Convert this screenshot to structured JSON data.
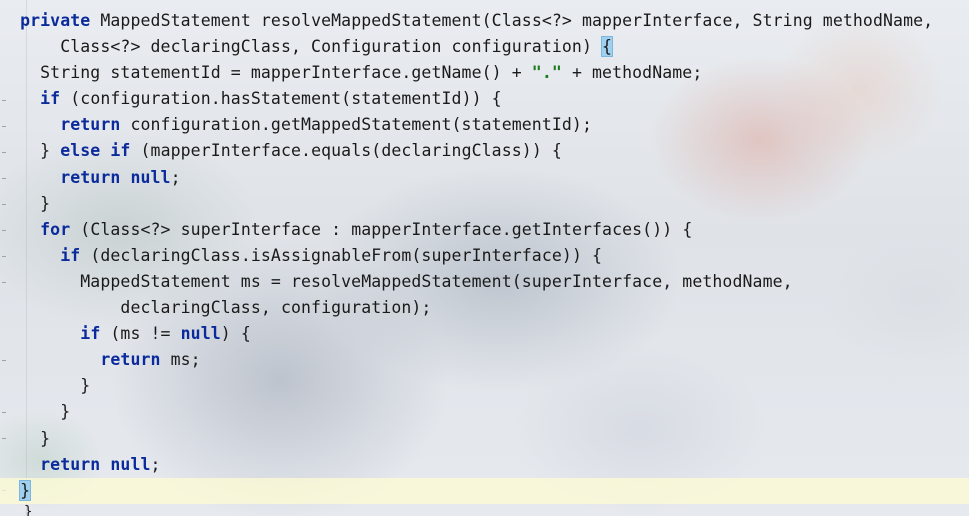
{
  "editor": {
    "language": "Java",
    "lines": [
      [
        {
          "t": "  "
        },
        {
          "t": "private",
          "k": "kw"
        },
        {
          "t": " MappedStatement resolveMappedStatement(Class<?> mapperInterface, String methodName,"
        }
      ],
      [
        {
          "t": "      Class<?> declaringClass, Configuration configuration) "
        },
        {
          "t": "{",
          "k": "brace-hl"
        }
      ],
      [
        {
          "t": "    String statementId = mapperInterface.getName() + "
        },
        {
          "t": "\".\"",
          "k": "str"
        },
        {
          "t": " + methodName;"
        }
      ],
      [
        {
          "t": "    "
        },
        {
          "t": "if",
          "k": "kw"
        },
        {
          "t": " (configuration.hasStatement(statementId)) {"
        }
      ],
      [
        {
          "t": "      "
        },
        {
          "t": "return",
          "k": "kw"
        },
        {
          "t": " configuration.getMappedStatement(statementId);"
        }
      ],
      [
        {
          "t": "    } "
        },
        {
          "t": "else",
          "k": "kw"
        },
        {
          "t": " "
        },
        {
          "t": "if",
          "k": "kw"
        },
        {
          "t": " (mapperInterface.equals(declaringClass)) {"
        }
      ],
      [
        {
          "t": "      "
        },
        {
          "t": "return",
          "k": "kw"
        },
        {
          "t": " "
        },
        {
          "t": "null",
          "k": "kw"
        },
        {
          "t": ";"
        }
      ],
      [
        {
          "t": "    }"
        }
      ],
      [
        {
          "t": "    "
        },
        {
          "t": "for",
          "k": "kw"
        },
        {
          "t": " (Class<?> superInterface : mapperInterface.getInterfaces()) {"
        }
      ],
      [
        {
          "t": "      "
        },
        {
          "t": "if",
          "k": "kw"
        },
        {
          "t": " (declaringClass.isAssignableFrom(superInterface)) {"
        }
      ],
      [
        {
          "t": "        MappedStatement ms = resolveMappedStatement(superInterface, methodName,"
        }
      ],
      [
        {
          "t": "            declaringClass, configuration);"
        }
      ],
      [
        {
          "t": "        "
        },
        {
          "t": "if",
          "k": "kw"
        },
        {
          "t": " (ms != "
        },
        {
          "t": "null",
          "k": "kw"
        },
        {
          "t": ") {"
        }
      ],
      [
        {
          "t": "          "
        },
        {
          "t": "return",
          "k": "kw"
        },
        {
          "t": " ms;"
        }
      ],
      [
        {
          "t": "        }"
        }
      ],
      [
        {
          "t": "      }"
        }
      ],
      [
        {
          "t": "    }"
        }
      ],
      [
        {
          "t": "    "
        },
        {
          "t": "return",
          "k": "kw"
        },
        {
          "t": " "
        },
        {
          "t": "null",
          "k": "kw"
        },
        {
          "t": ";"
        }
      ],
      [
        {
          "t": "  "
        },
        {
          "t": "}",
          "k": "brace-hl"
        }
      ]
    ],
    "trailing_text": "}"
  },
  "colors": {
    "keyword": "#0b2b9c",
    "string": "#1b7a1b",
    "text": "#1a1a1a",
    "brace_match_highlight": "#9fd0f0",
    "current_line_highlight": "#fffcd2"
  }
}
